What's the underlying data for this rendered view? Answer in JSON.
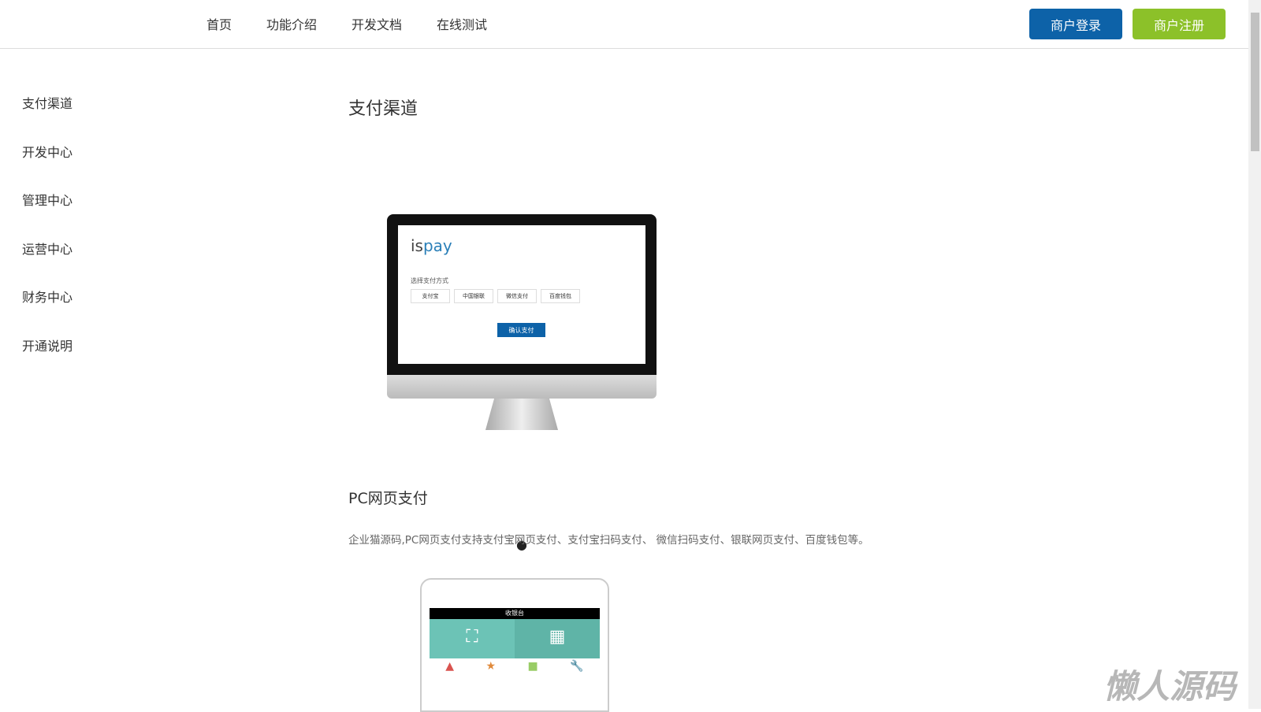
{
  "header": {
    "nav": [
      "首页",
      "功能介绍",
      "开发文档",
      "在线测试"
    ],
    "login": "商户登录",
    "register": "商户注册"
  },
  "sidebar": [
    "支付渠道",
    "开发中心",
    "管理中心",
    "运营中心",
    "财务中心",
    "开通说明"
  ],
  "main": {
    "title": "支付渠道",
    "section_title": "PC网页支付",
    "description": "企业猫源码,PC网页支付支持支付宝网页支付、支付宝扫码支付、 微信扫码支付、银联网页支付、百度钱包等。"
  },
  "imac_screen": {
    "logo_a": "is",
    "logo_b": "pay",
    "select_label": "选择支付方式",
    "options": [
      "支付宝",
      "中国银联",
      "微信支付",
      "百度钱包"
    ],
    "confirm": "确认支付"
  },
  "ipad_screen": {
    "title": "收银台"
  },
  "watermark": "懒人源码"
}
